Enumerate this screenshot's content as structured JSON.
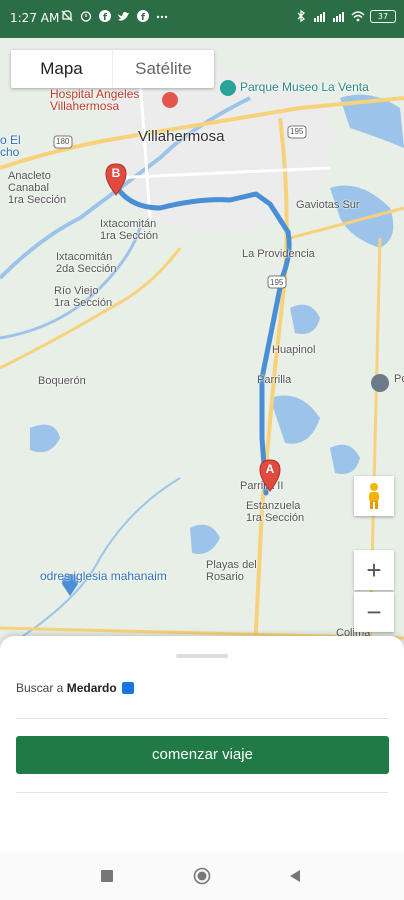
{
  "status": {
    "time": "1:27 AM",
    "battery": "37"
  },
  "map": {
    "toggle": {
      "map_label": "Mapa",
      "satellite_label": "Satélite"
    },
    "labels": {
      "hospital": "Hospital Angeles\nVillahermosa",
      "parque": "Parque Museo La Venta",
      "city": "Villahermosa",
      "el_cha": "o El\ncho",
      "anacleto": "Anacleto\nCanabal\n1ra Sección",
      "ixta1": "Ixtacomitán\n1ra Sección",
      "ixta2": "Ixtacomitán\n2da Sección",
      "rioviejo": "Río Viejo\n1ra Sección",
      "gaviotas": "Gaviotas Sur",
      "providencia": "La Providencia",
      "huapinol": "Huapinol",
      "parrilla": "Parrilla",
      "boqueron": "Boquerón",
      "parrilla2": "Parrilla II",
      "estanzuela": "Estanzuela\n1ra Sección",
      "playas": "Playas del\nRosario",
      "iglesia": "odres iglesia mahanaim",
      "colima": "Colima",
      "pcdn": "Pc",
      "road180": "180",
      "road195": "195",
      "road195b": "195"
    },
    "markers": {
      "a": "A",
      "b": "B"
    },
    "controls": {
      "zoom_in": "+",
      "zoom_out": "−"
    }
  },
  "sheet": {
    "search_prefix": "Buscar a",
    "contact_name": "Medardo",
    "start_button": "comenzar viaje"
  },
  "colors": {
    "status_bar": "#2b6e45",
    "primary_button": "#1f7a45",
    "route": "#4a8fd6"
  }
}
